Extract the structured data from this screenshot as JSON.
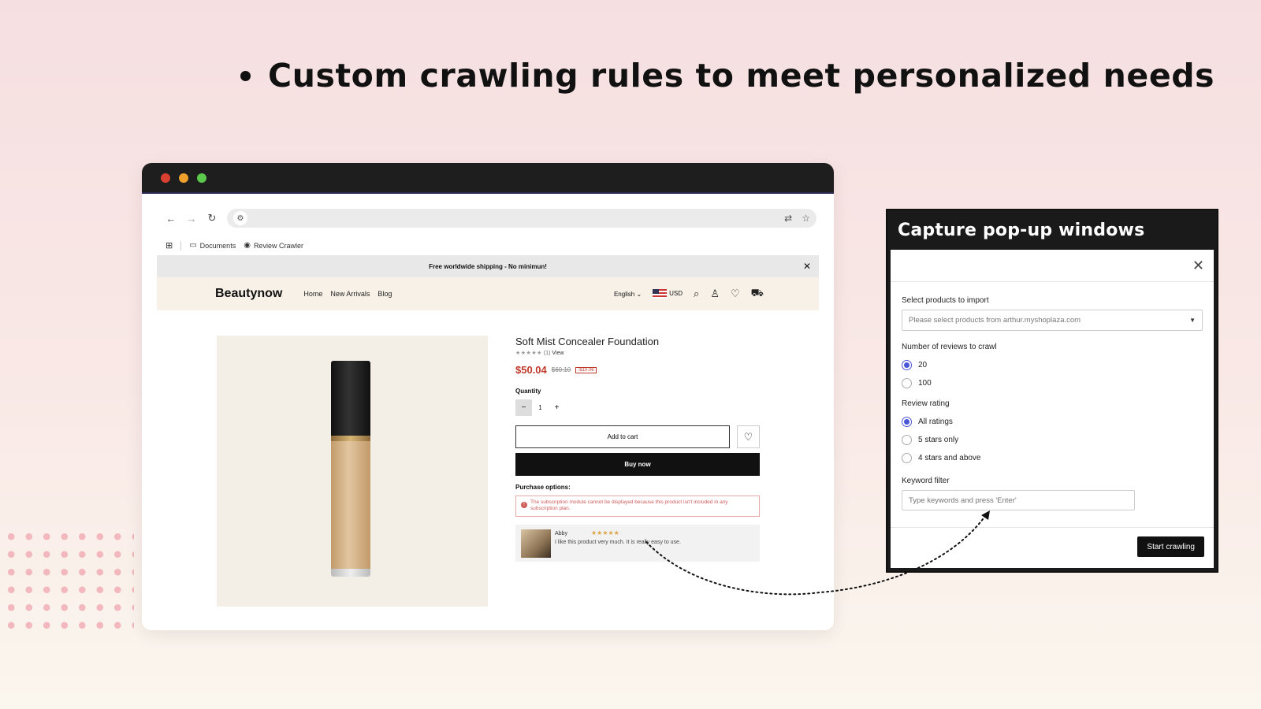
{
  "headline": "Custom crawling rules to meet personalized needs",
  "browser": {
    "bookmarks": [
      {
        "label": "Documents",
        "icon": "folder-icon"
      },
      {
        "label": "Review Crawler",
        "icon": "globe-icon"
      }
    ]
  },
  "store": {
    "announcement": "Free worldwide shipping - No minimun!",
    "brand": "Beautynow",
    "menu": [
      "Home",
      "New Arrivals",
      "Blog"
    ],
    "language": "English",
    "currency": "USD"
  },
  "product": {
    "title": "Soft Mist Concealer Foundation",
    "rating_count": "(1)",
    "rating_link": "View",
    "price": "$50.04",
    "compare_price": "$60.10",
    "discount": "-$10.06",
    "quantity_label": "Quantity",
    "quantity": "1",
    "add_to_cart": "Add to cart",
    "buy_now": "Buy now",
    "purchase_options_label": "Purchase options:",
    "subscription_note": "The subscription module cannot be displayed because this product isn't included in any subscription plan.",
    "review": {
      "name": "Abby",
      "stars": "★★★★★",
      "text": "I like this product very much. It is really easy to use."
    }
  },
  "panel": {
    "title": "Capture pop-up windows",
    "select_label": "Select products to import",
    "select_placeholder": "Please select products from arthur.myshoplaza.com",
    "reviews_label": "Number of reviews to crawl",
    "reviews_options": [
      {
        "label": "20",
        "selected": true
      },
      {
        "label": "100",
        "selected": false
      }
    ],
    "rating_label": "Review rating",
    "rating_options": [
      {
        "label": "All ratings",
        "selected": true
      },
      {
        "label": "5 stars only",
        "selected": false
      },
      {
        "label": "4 stars and above",
        "selected": false
      }
    ],
    "keyword_label": "Keyword filter",
    "keyword_placeholder": "Type keywords and press 'Enter'",
    "start_button": "Start crawling"
  },
  "colors": {
    "accent_radio": "#4a56d8",
    "price_red": "#c0392b",
    "dark": "#111111"
  }
}
